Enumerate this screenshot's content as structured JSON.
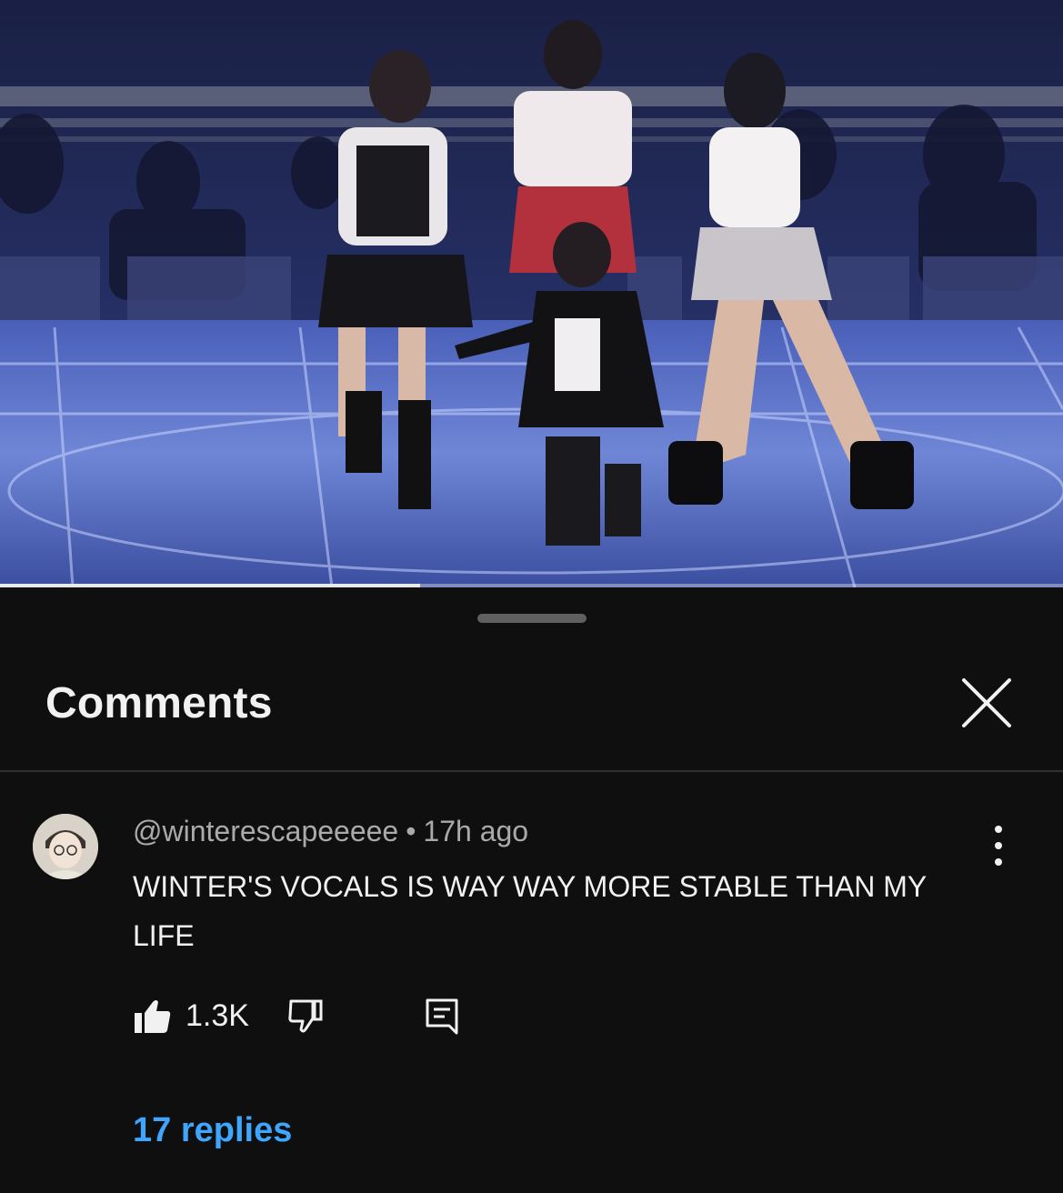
{
  "video": {
    "progress_fraction": 0.395,
    "scene_description_icon": "video-frame"
  },
  "panel": {
    "title": "Comments",
    "close_icon": "close-icon"
  },
  "comment": {
    "author": "@winterescapeeeee",
    "separator": "•",
    "time": "17h ago",
    "text": "WINTER'S VOCALS IS WAY WAY MORE STABLE THAN MY LIFE",
    "likes": "1.3K",
    "replies_label": "17 replies"
  },
  "colors": {
    "background": "#0f0f0f",
    "accent_link": "#3ea6ff",
    "meta_text": "#aaaaaa",
    "divider": "#303030"
  }
}
